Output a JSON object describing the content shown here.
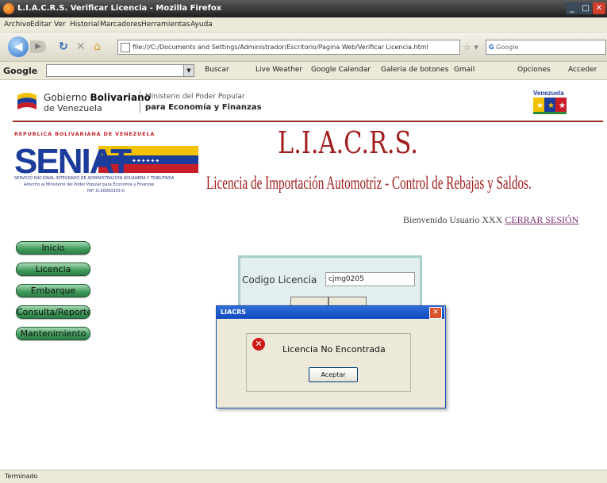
{
  "browser": {
    "title": "L.I.A.C.R.S. Verificar Licencia - Mozilla Firefox",
    "menu": [
      "Archivo",
      "Editar",
      "Ver",
      "Historial",
      "Marcadores",
      "Herramientas",
      "Ayuda"
    ],
    "url": "file:///C:/Documents and Settings/Administrador/Escritorio/Pagina Web/Verificar Licencia.html",
    "search_placeholder": "Google",
    "toolbar": {
      "google_label": "Google",
      "buscar": "Buscar",
      "items": [
        "Live Weather",
        "Google Calendar",
        "Galeria de botones",
        "Gmail"
      ],
      "opciones": "Opciones",
      "acceder": "Acceder"
    },
    "status": "Terminado",
    "colors": {
      "titlebar": "#2a2a2a",
      "chrome": "#ece9d8",
      "dialog_title": "#1a55c8"
    }
  },
  "header": {
    "gob_line1_a": "Gobierno ",
    "gob_line1_b": "Bolivariano",
    "gob_line2": "de Venezuela",
    "ministerio_line1": "Ministerio del Poder Popular",
    "ministerio_line2": "para Economía y Finanzas",
    "venezuela_label": "Venezuela"
  },
  "seniat": {
    "republica": "REPUBLICA BOLIVARIANA DE VENEZUELA",
    "brand": "SENIAT",
    "desc1": "SERVICIO NACIONAL INTEGRADO DE ADMINISTRACION ADUANERA Y TRIBUTARIA",
    "desc2": "Adscrito al Ministerio del Poder Popular para Economía y Finanzas",
    "rif": "RIF: G-20000303-0"
  },
  "app": {
    "title": "L.I.A.C.R.S.",
    "subtitle": "Licencia de Importación Automotriz - Control de Rebajas y Saldos.",
    "welcome": "Bienvenido Usuario XXX ",
    "logout": "CERRAR SESIÓN",
    "colors": {
      "title": "#a01e1e",
      "menu_button": "#3e9a5a"
    }
  },
  "sidebar": {
    "items": [
      "Inicio",
      "Licencia",
      "Embarque",
      "Consulta/Reporte",
      "Mantenimiento"
    ]
  },
  "form": {
    "codigo_label": "Codigo Licencia",
    "codigo_value": "cjmg0205"
  },
  "dialog": {
    "title": "LIACRS",
    "message": "Licencia No Encontrada",
    "accept": "Aceptar"
  }
}
